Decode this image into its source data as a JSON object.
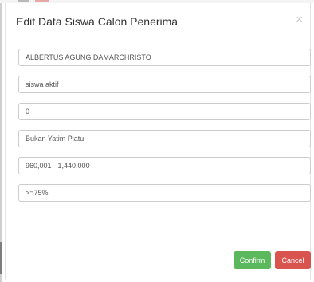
{
  "modal": {
    "title": "Edit Data Siswa Calon Penerima",
    "close_glyph": "×",
    "close_icon": "close-icon"
  },
  "fields": [
    {
      "name": "nama",
      "value": "ALBERTUS AGUNG DAMARCHRISTO"
    },
    {
      "name": "status-siswa",
      "value": "siswa aktif"
    },
    {
      "name": "jumlah",
      "value": "0"
    },
    {
      "name": "status-yatim-piatu",
      "value": "Bukan Yatim Piatu"
    },
    {
      "name": "penghasilan",
      "value": "960,001 - 1,440,000"
    },
    {
      "name": "kehadiran",
      "value": ">=75%"
    }
  ],
  "footer": {
    "confirm_label": "Confirm",
    "cancel_label": "Cancel"
  },
  "colors": {
    "confirm": "#5cb85c",
    "cancel": "#d9534f"
  }
}
